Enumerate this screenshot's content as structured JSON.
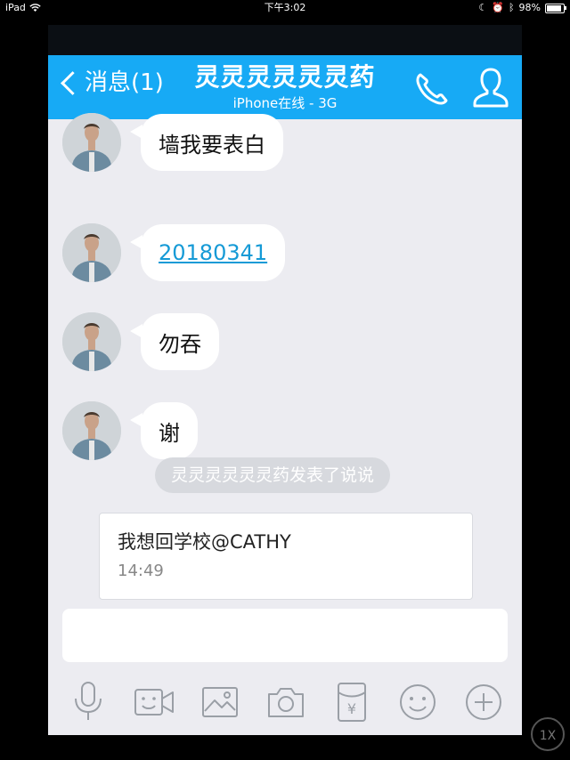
{
  "status_bar": {
    "device": "iPad",
    "time": "下午3:02",
    "battery": "98%"
  },
  "nav": {
    "back_label": "消息(1)",
    "title": "灵灵灵灵灵灵药",
    "subtitle": "iPhone在线 - 3G"
  },
  "messages": [
    {
      "text": "墙我要表白"
    },
    {
      "text": "20180341",
      "is_link": true
    },
    {
      "text": "勿吞"
    },
    {
      "text": "谢"
    }
  ],
  "system_notice": "灵灵灵灵灵灵药发表了说说",
  "post_card": {
    "text": "我想回学校@CATHY",
    "time": "14:49"
  },
  "toolbar": [
    "microphone-icon",
    "video-call-icon",
    "image-icon",
    "camera-icon",
    "red-packet-icon",
    "emoji-icon",
    "plus-icon"
  ],
  "zoom_badge": "1X",
  "colors": {
    "nav_bar": "#17aaf5",
    "chat_background": "#ececf1",
    "link": "#159ad6"
  }
}
